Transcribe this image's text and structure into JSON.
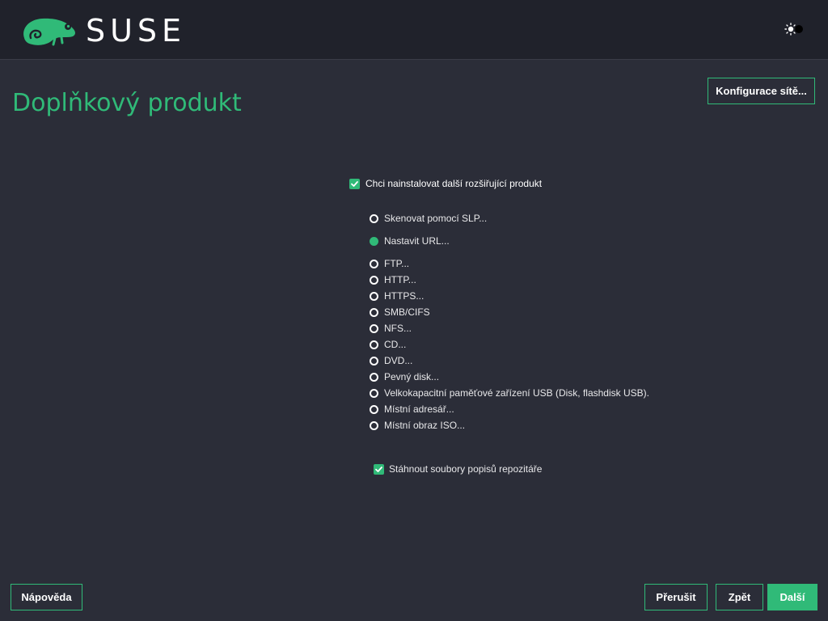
{
  "header": {
    "brand": "SUSE",
    "theme_toggle_icon": "sun-moon-icon"
  },
  "page": {
    "title": "Doplňkový produkt"
  },
  "buttons": {
    "network_config": "Konfigurace sítě...",
    "help": "Nápověda",
    "abort": "Přerušit",
    "back": "Zpět",
    "next": "Další"
  },
  "install_addon": {
    "label": "Chci nainstalovat další rozšiřující produkt",
    "checked": true
  },
  "sources": [
    {
      "label": "Skenovat pomocí SLP...",
      "selected": false
    },
    {
      "label": "Nastavit URL...",
      "selected": true
    },
    {
      "label": "FTP...",
      "selected": false
    },
    {
      "label": "HTTP...",
      "selected": false
    },
    {
      "label": "HTTPS...",
      "selected": false
    },
    {
      "label": "SMB/CIFS",
      "selected": false
    },
    {
      "label": "NFS...",
      "selected": false
    },
    {
      "label": "CD...",
      "selected": false
    },
    {
      "label": "DVD...",
      "selected": false
    },
    {
      "label": "Pevný disk...",
      "selected": false
    },
    {
      "label": "Velkokapacitní paměťové zařízení USB (Disk, flashdisk USB).",
      "selected": false
    },
    {
      "label": "Místní adresář...",
      "selected": false
    },
    {
      "label": "Místní obraz ISO...",
      "selected": false
    }
  ],
  "download_descriptions": {
    "label": "Stáhnout soubory popisů repozitáře",
    "checked": true
  },
  "colors": {
    "accent": "#30ba78",
    "background": "#2b2d38",
    "header": "#20222b"
  }
}
